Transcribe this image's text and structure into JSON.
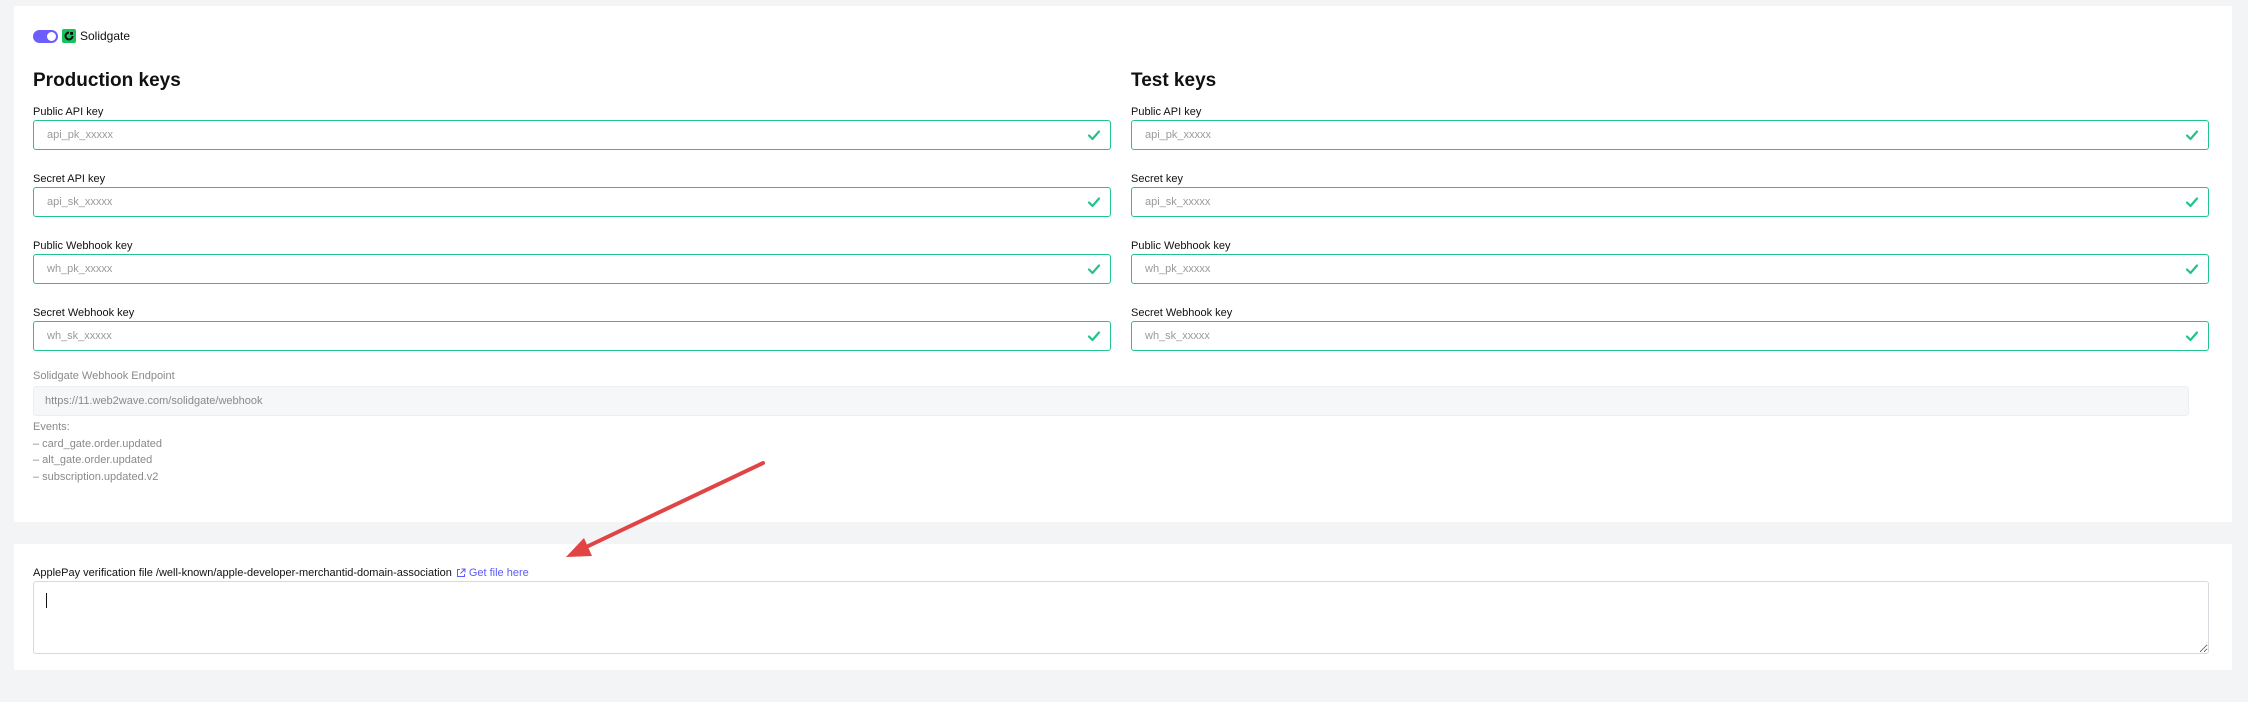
{
  "provider": {
    "name": "Solidgate",
    "enabled": true
  },
  "production": {
    "title": "Production keys",
    "fields": [
      {
        "label": "Public API key",
        "placeholder": "api_pk_xxxxx"
      },
      {
        "label": "Secret API key",
        "placeholder": "api_sk_xxxxx"
      },
      {
        "label": "Public Webhook key",
        "placeholder": "wh_pk_xxxxx"
      },
      {
        "label": "Secret Webhook key",
        "placeholder": "wh_sk_xxxxx"
      }
    ]
  },
  "test": {
    "title": "Test keys",
    "fields": [
      {
        "label": "Public API key",
        "placeholder": "api_pk_xxxxx"
      },
      {
        "label": "Secret key",
        "placeholder": "api_sk_xxxxx"
      },
      {
        "label": "Public Webhook key",
        "placeholder": "wh_pk_xxxxx"
      },
      {
        "label": "Secret Webhook key",
        "placeholder": "wh_sk_xxxxx"
      }
    ]
  },
  "webhook": {
    "label": "Solidgate Webhook Endpoint",
    "url": "https://11.web2wave.com/solidgate/webhook",
    "events_heading": "Events:",
    "events": [
      "– card_gate.order.updated",
      "– alt_gate.order.updated",
      "– subscription.updated.v2"
    ]
  },
  "applepay": {
    "label": "ApplePay verification file /well-known/apple-developer-merchantid-domain-association",
    "link_text": "Get file here",
    "value": ""
  },
  "colors": {
    "accent": "#6d5dfc",
    "valid_border": "#22c38e",
    "brand": "#12c45a",
    "link": "#5b5ef0",
    "annotation_arrow": "#e04444"
  },
  "icons": {
    "check": "check-icon",
    "external_link": "external-link-icon",
    "brand": "solidgate-logo-icon"
  }
}
